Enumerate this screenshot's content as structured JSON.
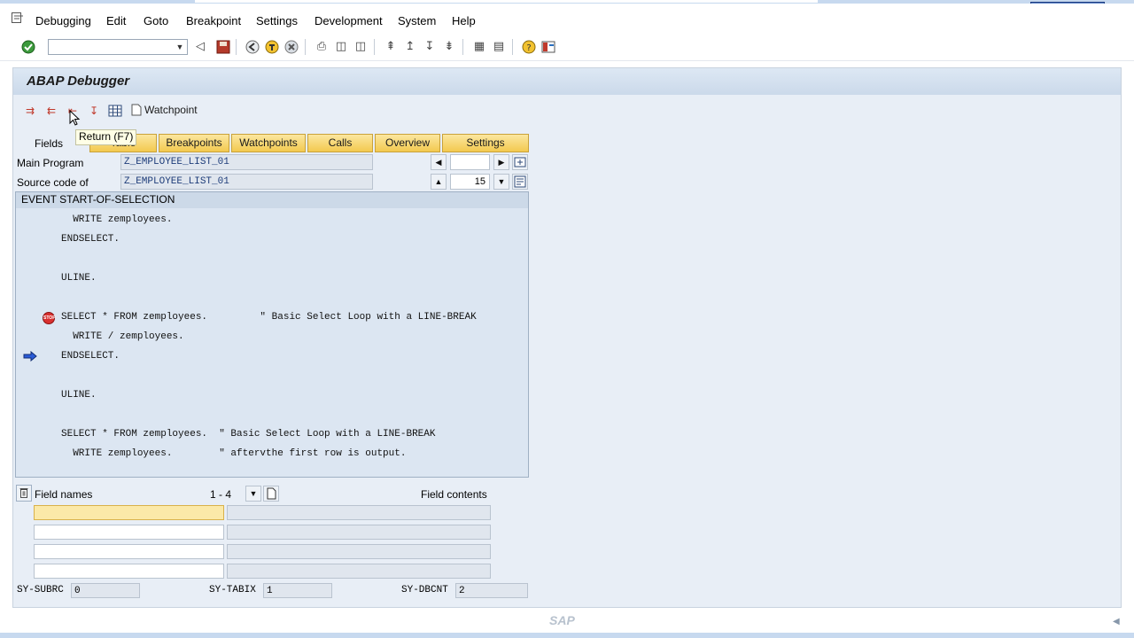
{
  "menubar": {
    "items": [
      "Debugging",
      "Edit",
      "Goto",
      "Breakpoint",
      "Settings",
      "Development",
      "System",
      "Help"
    ]
  },
  "window_controls": [
    "minimize-icon",
    "restore-icon",
    "close-icon"
  ],
  "toolbar": {
    "command_field_value": "",
    "icons": [
      "enter-icon",
      "back-icon",
      "save-icon",
      "nav-back-icon",
      "exit-icon",
      "cancel-icon",
      "print-icon",
      "find-icon",
      "find-next-icon",
      "first-page-icon",
      "prev-page-icon",
      "next-page-icon",
      "last-page-icon",
      "new-session-icon",
      "shortcut-icon",
      "help-icon",
      "layout-icon"
    ]
  },
  "screen": {
    "title": "ABAP Debugger",
    "app_toolbar": {
      "icons": [
        "single-step-icon",
        "execute-icon",
        "return-icon",
        "continue-icon",
        "table-icon"
      ],
      "watchpoint_label": "Watchpoint"
    },
    "tooltip": "Return  (F7)",
    "fields_label": "Fields",
    "tabs": [
      "Table",
      "Breakpoints",
      "Watchpoints",
      "Calls",
      "Overview",
      "Settings"
    ],
    "main_program_label": "Main Program",
    "main_program_value": "Z_EMPLOYEE_LIST_01",
    "source_code_label": "Source code of",
    "source_code_value": "Z_EMPLOYEE_LIST_01",
    "line_number": "15",
    "code_header": "EVENT START-OF-SELECTION",
    "code_lines": [
      "  WRITE zemployees.",
      "ENDSELECT.",
      "",
      "ULINE.",
      "",
      "SELECT * FROM zemployees.         \" Basic Select Loop with a LINE-BREAK",
      "  WRITE / zemployees.",
      "ENDSELECT.",
      "",
      "ULINE.",
      "",
      "SELECT * FROM zemployees.  \" Basic Select Loop with a LINE-BREAK",
      "  WRITE zemployees.        \" aftervthe first row is output."
    ],
    "field_names_label": "Field names",
    "field_range": "1 - 4",
    "field_contents_label": "Field contents",
    "field_rows": [
      {
        "name": "",
        "value": ""
      },
      {
        "name": "",
        "value": ""
      },
      {
        "name": "",
        "value": ""
      },
      {
        "name": "",
        "value": ""
      }
    ],
    "sys_fields": [
      {
        "label": "SY-SUBRC",
        "value": "0"
      },
      {
        "label": "SY-TABIX",
        "value": "1"
      },
      {
        "label": "SY-DBCNT",
        "value": "2"
      }
    ]
  },
  "footer": {
    "logo": "SAP"
  }
}
